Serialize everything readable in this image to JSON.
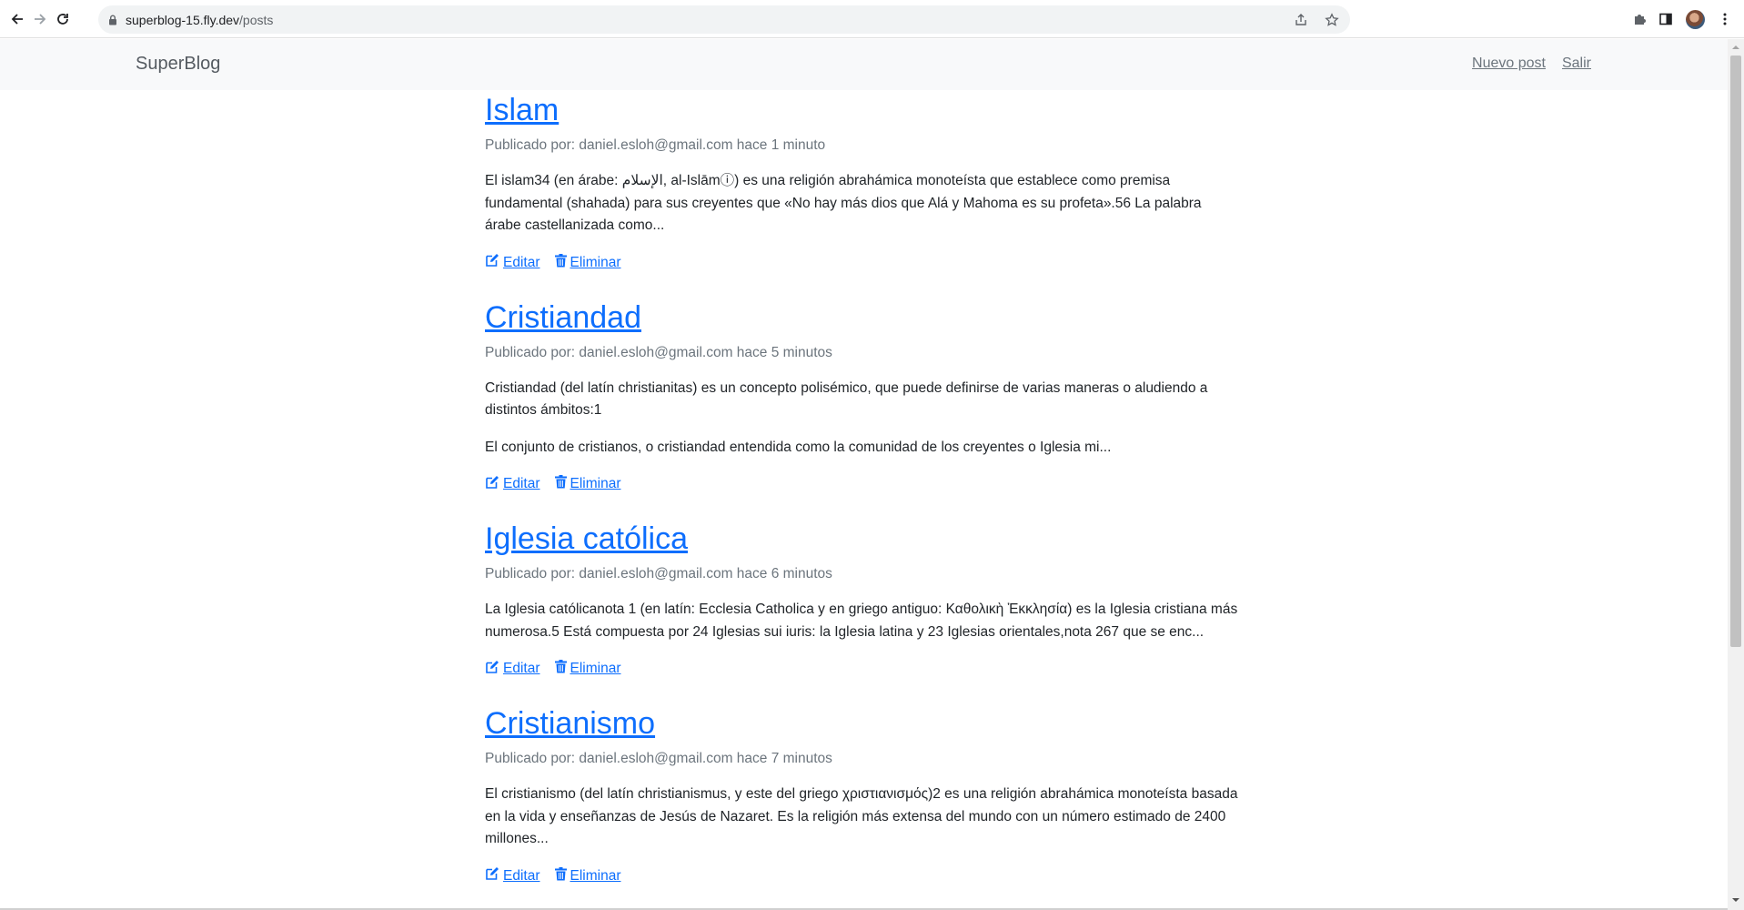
{
  "browser": {
    "url_host": "superblog-15.fly.dev",
    "url_path": "/posts"
  },
  "navbar": {
    "brand": "SuperBlog",
    "links": [
      "Nuevo post",
      "Salir"
    ]
  },
  "posts": [
    {
      "title": "Islam",
      "meta": "Publicado por: daniel.esloh@gmail.com hace 1 minuto",
      "paragraphs": [
        "El islam34 (en árabe: الإسلام, al-Islāmⓘ) es una religión abrahámica monoteísta que establece como premisa fundamental (shahada) para sus creyentes que «No hay más dios que Alá y Mahoma es su profeta».56 La palabra árabe castellanizada como..."
      ],
      "edit": "Editar",
      "delete": "Eliminar"
    },
    {
      "title": "Cristiandad",
      "meta": "Publicado por: daniel.esloh@gmail.com hace 5 minutos",
      "paragraphs": [
        "Cristiandad (del latín christianitas) es un concepto polisémico, que puede definirse de varias maneras o aludiendo a distintos ámbitos:1",
        "El conjunto de cristianos, o cristiandad entendida como la comunidad de los creyentes o Iglesia mi..."
      ],
      "edit": "Editar",
      "delete": "Eliminar"
    },
    {
      "title": "Iglesia católica",
      "meta": "Publicado por: daniel.esloh@gmail.com hace 6 minutos",
      "paragraphs": [
        "La Iglesia católicanota 1 (en latín: Ecclesia Catholica y en griego antiguo: Καθολικὴ Ἐκκλησία) es la Iglesia cristiana más numerosa.5 Está compuesta por 24 Iglesias sui iuris: la Iglesia latina y 23 Iglesias orientales,nota 267 que se enc..."
      ],
      "edit": "Editar",
      "delete": "Eliminar"
    },
    {
      "title": "Cristianismo",
      "meta": "Publicado por: daniel.esloh@gmail.com hace 7 minutos",
      "paragraphs": [
        "El cristianismo (del latín christianismus, y este del griego χριστιανισμός)2 es una religión abrahámica monoteísta basada en la vida y enseñanzas de Jesús de Nazaret. Es la religión más extensa del mundo con un número estimado de 2400 millones..."
      ],
      "edit": "Editar",
      "delete": "Eliminar"
    }
  ],
  "colors": {
    "link": "#0d6efd",
    "muted": "#6c757d",
    "navbar_bg": "#f8f9fa"
  }
}
